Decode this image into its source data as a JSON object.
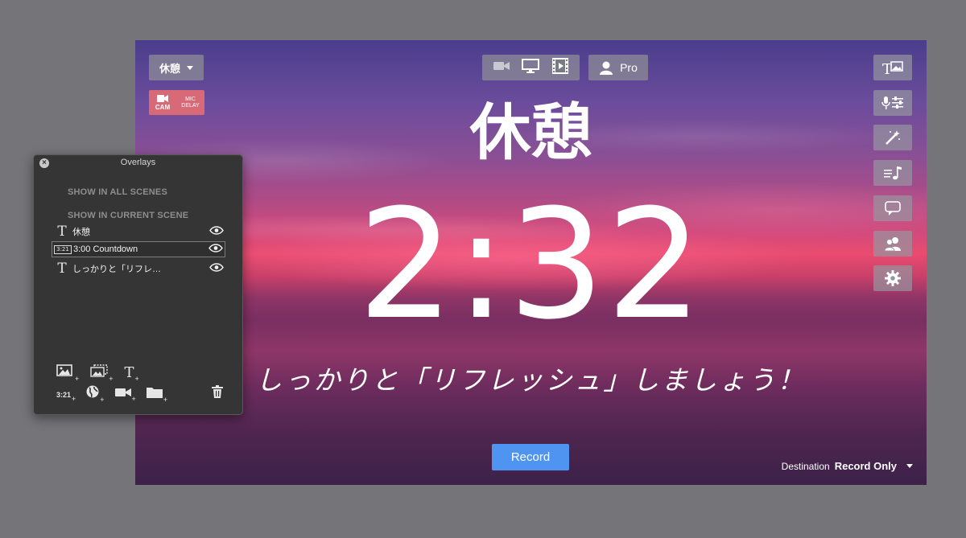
{
  "scene": {
    "name": "休憩"
  },
  "camdelay": {
    "cam_label": "CAM",
    "mic_line1": "MIC",
    "mic_line2": "DELAY"
  },
  "toolbar": {
    "pro_label": "Pro",
    "sources": [
      "camera-icon",
      "monitor-icon",
      "film-icon"
    ]
  },
  "stage": {
    "title": "休憩",
    "timer": "2:32",
    "subtitle": "しっかりと「リフレッシュ」しましょう！"
  },
  "side_buttons": [
    "text-image-icon",
    "mic-mixer-icon",
    "magic-wand-icon",
    "music-playlist-icon",
    "speech-bubble-icon",
    "people-icon",
    "gear-icon"
  ],
  "record": {
    "label": "Record"
  },
  "destination": {
    "label": "Destination",
    "value": "Record Only"
  },
  "overlays": {
    "title": "Overlays",
    "section_all": "SHOW IN ALL SCENES",
    "section_current": "SHOW IN CURRENT SCENE",
    "items": [
      {
        "icon": "text-icon",
        "label": "休憩"
      },
      {
        "icon": "countdown-icon",
        "badge": "3:21",
        "label": "3:00 Countdown",
        "selected": true
      },
      {
        "icon": "text-icon",
        "label": "しっかりと「リフレ…"
      }
    ],
    "add_tools_row1": [
      "add-image-icon",
      "add-slideshow-icon",
      "add-text-icon"
    ],
    "add_tools_row2_countdown": "3:21",
    "add_tools_row2": [
      "add-countdown-icon",
      "add-web-icon",
      "add-camera-icon",
      "add-folder-icon"
    ],
    "delete": "trash-icon"
  },
  "colors": {
    "record": "#4e94f0",
    "camdelay": "#d86a78",
    "panel": "#353535",
    "desktop": "#757579"
  }
}
